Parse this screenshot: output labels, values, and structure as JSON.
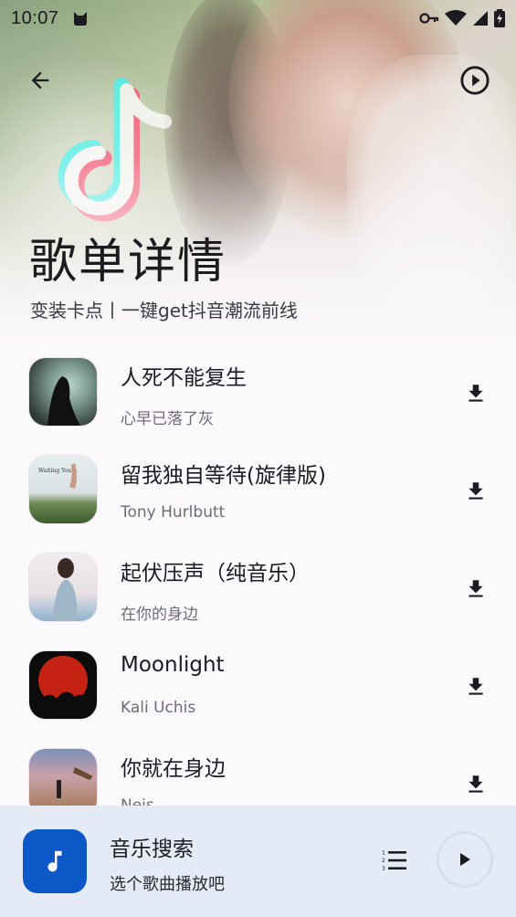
{
  "status_bar": {
    "time": "10:07"
  },
  "header": {
    "title": "歌单详情",
    "subtitle": "变装卡点丨一键get抖音潮流前线"
  },
  "songs": [
    {
      "title": "人死不能复生",
      "artist": "心早已落了灰",
      "cover_colors": [
        "#3b4a3a",
        "#9fb8b0"
      ]
    },
    {
      "title": "留我独自等待(旋律版)",
      "artist": "Tony Hurlbutt",
      "cover_colors": [
        "#dfe6e7",
        "#4d6a3e"
      ]
    },
    {
      "title": "起伏压声（纯音乐）",
      "artist": "在你的身边",
      "cover_colors": [
        "#e9e4e6",
        "#7ca3c2"
      ]
    },
    {
      "title": "Moonlight",
      "artist": "Kali Uchis",
      "cover_colors": [
        "#b01e12",
        "#0c0c0c"
      ]
    },
    {
      "title": "你就在身边",
      "artist": "Neis",
      "cover_colors": [
        "#7d8fb8",
        "#a0764c"
      ]
    }
  ],
  "player": {
    "title": "音乐搜索",
    "subtitle": "选个歌曲播放吧",
    "accent": "#0d58c7"
  }
}
